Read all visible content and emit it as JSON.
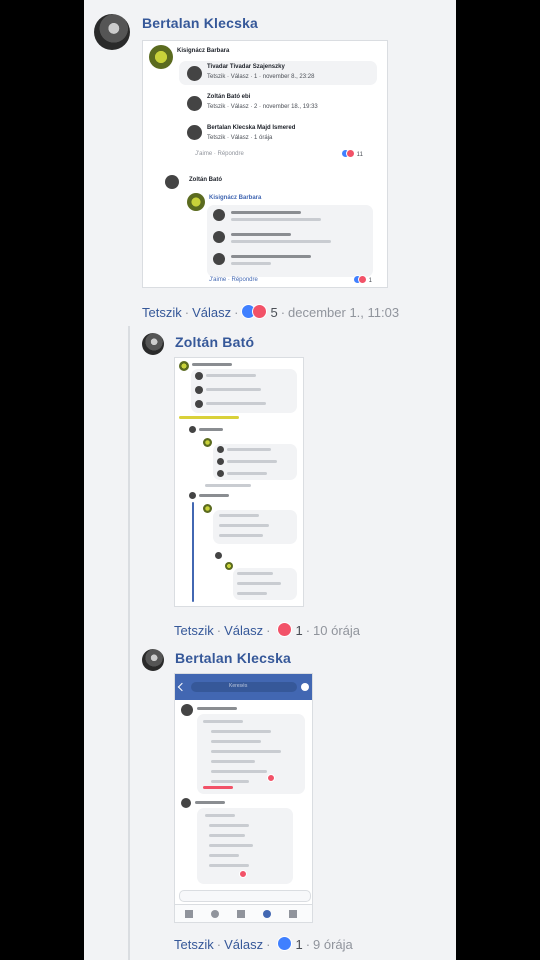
{
  "comments": [
    {
      "author": "Bertalan Klecska",
      "like": "Tetszik",
      "reply": "Válasz",
      "reactions": {
        "types": [
          "like",
          "love"
        ],
        "count": "5"
      },
      "time": "december 1., 11:03",
      "screenshot": {
        "top_author": "Kisignácz Barbara",
        "replies": [
          {
            "author": "Tivadar Tivadar Szajenszky",
            "like": "Tetszik",
            "reply": "Válasz",
            "count": "1",
            "time": "november 8., 23:28"
          },
          {
            "author": "Zoltán Bató ebi",
            "like": "Tetszik",
            "reply": "Válasz",
            "count": "2",
            "time": "november 18., 19:33"
          },
          {
            "author": "Bertalan Klecska Majd Ismered",
            "like": "Tetszik",
            "reply": "Válasz",
            "count": "",
            "time": "1 órája"
          }
        ],
        "footer": {
          "a": "J'aime",
          "b": "Répondre",
          "count": "11"
        },
        "nested_author": "Zoltán Bató",
        "nested_top": "Kisignácz Barbara",
        "nested_footer": {
          "a": "J'aime",
          "b": "Répondre",
          "count": "1"
        }
      }
    },
    {
      "author": "Zoltán Bató",
      "like": "Tetszik",
      "reply": "Válasz",
      "reactions": {
        "types": [
          "love"
        ],
        "count": "1"
      },
      "time": "10 órája"
    },
    {
      "author": "Bertalan Klecska",
      "like": "Tetszik",
      "reply": "Válasz",
      "reactions": {
        "types": [
          "like"
        ],
        "count": "1"
      },
      "time": "9 órája",
      "phone": {
        "search_placeholder": "Keresés"
      }
    }
  ],
  "colors": {
    "link": "#365899",
    "like": "#4080ff",
    "love": "#f25268",
    "panel": "#f2f3f5"
  }
}
